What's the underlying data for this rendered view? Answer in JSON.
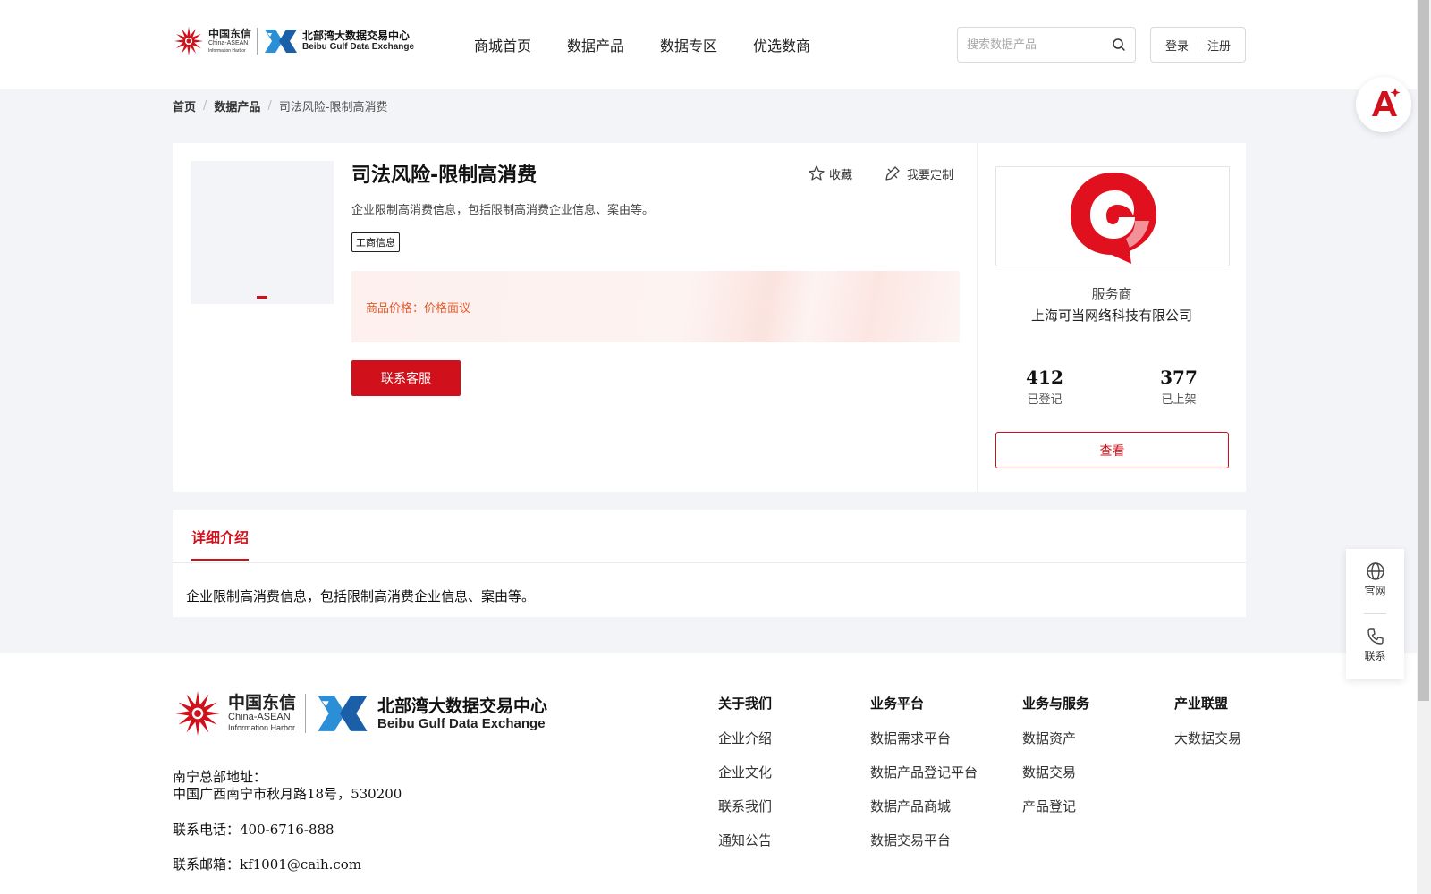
{
  "header": {
    "logo_caih_cn": "中国东信",
    "logo_caih_en1": "China-ASEAN",
    "logo_caih_en2": "Information Harbor",
    "logo_bgx_cn": "北部湾大数据交易中心",
    "logo_bgx_en": "Beibu Gulf Data Exchange",
    "nav": [
      "商城首页",
      "数据产品",
      "数据专区",
      "优选数商"
    ],
    "search_placeholder": "搜索数据产品",
    "login": "登录",
    "register": "注册"
  },
  "breadcrumb": {
    "home": "首页",
    "category": "数据产品",
    "current": "司法风险-限制高消费"
  },
  "product": {
    "title": "司法风险-限制高消费",
    "description": "企业限制高消费信息，包括限制高消费企业信息、案由等。",
    "tag": "工商信息",
    "favorite": "收藏",
    "customize": "我要定制",
    "price_label": "商品价格：",
    "price_value": "价格面议",
    "contact_button": "联系客服"
  },
  "provider": {
    "role": "服务商",
    "name": "上海可当网络科技有限公司",
    "registered_count": "412",
    "registered_label": "已登记",
    "listed_count": "377",
    "listed_label": "已上架",
    "view_button": "查看"
  },
  "detail": {
    "tab": "详细介绍",
    "text": "企业限制高消费信息，包括限制高消费企业信息、案由等。"
  },
  "footer": {
    "address_label": "南宁总部地址：",
    "address": "中国广西南宁市秋月路18号，530200",
    "phone": "联系电话：400-6716-888",
    "email": "联系邮箱：kf1001@caih.com",
    "columns": [
      {
        "title": "关于我们",
        "links": [
          "企业介绍",
          "企业文化",
          "联系我们",
          "通知公告"
        ]
      },
      {
        "title": "业务平台",
        "links": [
          "数据需求平台",
          "数据产品登记平台",
          "数据产品商城",
          "数据交易平台"
        ]
      },
      {
        "title": "业务与服务",
        "links": [
          "数据资产",
          "数据交易",
          "产品登记"
        ]
      },
      {
        "title": "产业联盟",
        "links": [
          "大数据交易"
        ]
      }
    ]
  },
  "side_tools": {
    "website": "官网",
    "contact": "联系"
  },
  "colors": {
    "brand_red": "#d0111b",
    "price_orange": "#e25c2b",
    "page_bg": "#f3f4f7"
  },
  "icons": [
    "sunburst-logo-icon",
    "bgx-logo-icon",
    "search-icon",
    "star-icon",
    "edit-icon",
    "ai-assistant-icon",
    "globe-icon",
    "phone-icon"
  ]
}
